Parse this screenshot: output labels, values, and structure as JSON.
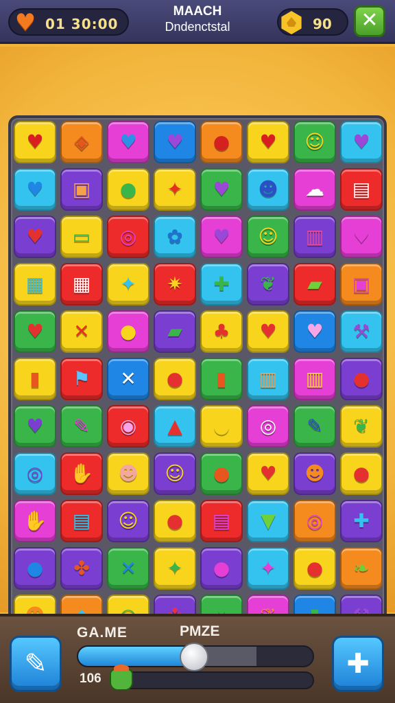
{
  "topbar": {
    "lives_text": "01 30:00",
    "title_line1": "MAACH",
    "title_line2": "Dndenctstal",
    "coins_text": "90",
    "close_glyph": "✕"
  },
  "colors": {
    "red": "#ee2b2b",
    "orange": "#f58a1f",
    "yellow": "#f8d51c",
    "green": "#39b54a",
    "blue": "#1f86e6",
    "cyan": "#33c3ee",
    "purple": "#7a3fd1",
    "pink": "#e53fd6",
    "lime": "#8cd13a"
  },
  "board": {
    "columns": 8,
    "rows": 11,
    "tiles": [
      [
        "heart|yellow|#d81e1e",
        "candy|orange|#e8561f",
        "heart|pink|#2d8fe6",
        "heart|blue|#9b48d8",
        "bug|orange|#d52020",
        "heart|yellow|#d81e1e",
        "smile|green|#f8d51c",
        "heart|cyan|#9b48d8"
      ],
      [
        "heart|cyan|#1f86e6",
        "box|purple|#f5a04a",
        "blob|yellow|#39b54a",
        "bird|yellow|#e8301f",
        "heart|green|#9b48d8",
        "face|cyan|#2d4fc6",
        "ghost|pink|#ffffff",
        "card|red|#ffffff"
      ],
      [
        "heart|purple|#e53030",
        "cash|yellow|#39b54a",
        "swirl|red|#e53fd6",
        "cloud|cyan|#1f6fd6",
        "heart|pink|#9b48d8",
        "smile|green|#f8d51c",
        "jar|purple|#e84aa0",
        "heart|pink|#e53fd6"
      ],
      [
        "note|yellow|#33c3ee",
        "calendar|red|#ffffff",
        "bird|yellow|#33c3ee",
        "fan|red|#f8d51c",
        "robot|cyan|#39b54a",
        "fruit|purple|#39b54a",
        "pill|red|#6fd13a",
        "box|orange|#e53fd6"
      ],
      [
        "heart|green|#e53030",
        "tools|yellow|#e8301f",
        "blob|pink|#f8d51c",
        "cucumber|purple|#39b54a",
        "plant|yellow|#e53030",
        "heart|yellow|#e53030",
        "heart|blue|#f5a6e8",
        "hammer|cyan|#9b48d8"
      ],
      [
        "bottle|yellow|#e8561f",
        "flag|red|#5ec4ff",
        "tools|blue|#ffffff",
        "apple|yellow|#e53030",
        "tube|green|#e8561f",
        "jar|cyan|#f5a04a",
        "jar|pink|#f8d51c",
        "apple|purple|#e53030"
      ],
      [
        "heart|green|#7a3fd1",
        "pencil|green|#e53fd6",
        "donut|red|#f5a6e8",
        "tent|cyan|#e53030",
        "blob|yellow|#f8d51c",
        "swirl|pink|#ffffff",
        "pencil|green|#2d4fc6",
        "fruit|yellow|#39b54a"
      ],
      [
        "swirl|cyan|#7a3fd1",
        "glove|red|#33c3ee",
        "face|yellow|#f5a6a0",
        "smile|purple|#f8d51c",
        "blob|green|#e8561f",
        "heart|yellow|#e53030",
        "face|purple|#f58a1f",
        "apple|yellow|#e53030"
      ],
      [
        "glove|pink|#b48ae8",
        "bag|red|#33c3ee",
        "smile|purple|#f8d51c",
        "apple|yellow|#e53030",
        "card|red|#e53fd6",
        "cup|cyan|#6fd13a",
        "swirl|orange|#e53fd6",
        "robot|purple|#33c3ee"
      ],
      [
        "balloon|purple|#1f86e6",
        "bow|purple|#e8561f",
        "tools|green|#1f86e6",
        "bird|yellow|#39b54a",
        "blob|purple|#e53fd6",
        "bird|cyan|#e53fd6",
        "apple|yellow|#e53030",
        "leaf|orange|#6fd13a"
      ],
      [
        "face|yellow|#f58a1f",
        "drop|orange|#33c3ee",
        "bowl|yellow|#39b54a",
        "bow|purple|#e53050",
        "clover|green|#39b54a",
        "fruit|pink|#f58a1f",
        "tube|blue|#39b54a",
        "hammer|purple|#9b48d8"
      ]
    ]
  },
  "bottombar": {
    "left_button_glyph": "✎",
    "right_button_glyph": "✚",
    "game_label": "GA.ME",
    "prize_label": "PMZE",
    "progress": 0.5,
    "ghost_progress": 0.76,
    "count_label": "106"
  }
}
